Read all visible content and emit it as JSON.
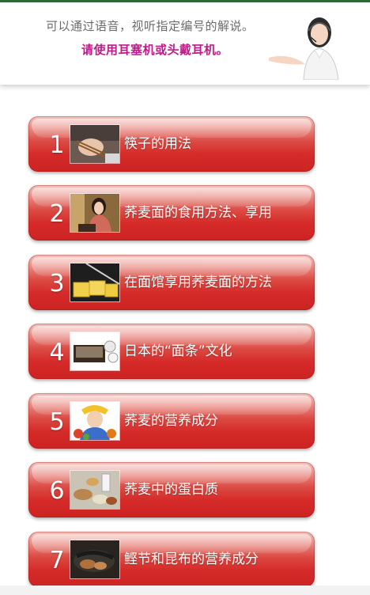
{
  "header": {
    "line1": "可以通过语音，视听指定编号的解说。",
    "line2": "请使用耳塞机或头戴耳机。"
  },
  "menu": [
    {
      "number": "1",
      "label": "筷子的用法",
      "image": "chopsticks-photo"
    },
    {
      "number": "2",
      "label": "荞麦面的食用方法、享用",
      "image": "woman-eating-soba-photo"
    },
    {
      "number": "3",
      "label": "在面馆享用荞麦面的方法",
      "image": "tamagoyaki-photo"
    },
    {
      "number": "4",
      "label": "日本的“面条”文化",
      "image": "zaru-soba-photo"
    },
    {
      "number": "5",
      "label": "荞麦的营养成分",
      "image": "child-with-vegetables-photo"
    },
    {
      "number": "6",
      "label": "荞麦中的蛋白质",
      "image": "protein-foods-photo"
    },
    {
      "number": "7",
      "label": "鲣节和昆布的营养成分",
      "image": "katsuobushi-kombu-photo"
    }
  ],
  "colors": {
    "accent_pink": "#c0198a",
    "button_red": "#d52a28",
    "header_text": "#6b6b6b"
  }
}
